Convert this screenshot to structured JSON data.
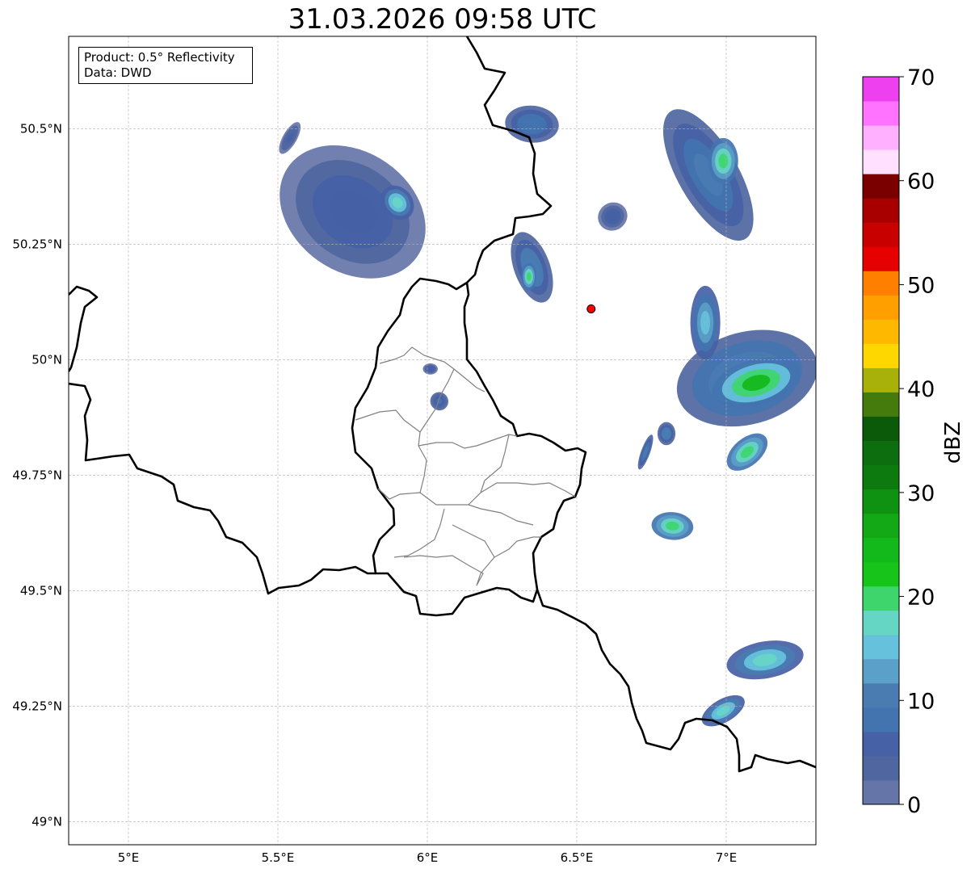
{
  "title": "31.03.2026 09:58 UTC",
  "info": {
    "product": "Product: 0.5° Reflectivity",
    "data": "Data: DWD"
  },
  "map": {
    "lon_range": [
      4.8,
      7.3
    ],
    "lat_range": [
      48.95,
      50.7
    ],
    "lon_ticks": [
      {
        "value": 5.0,
        "label": "5°E"
      },
      {
        "value": 5.5,
        "label": "5.5°E"
      },
      {
        "value": 6.0,
        "label": "6°E"
      },
      {
        "value": 6.5,
        "label": "6.5°E"
      },
      {
        "value": 7.0,
        "label": "7°E"
      }
    ],
    "lat_ticks": [
      {
        "value": 49.0,
        "label": "49°N"
      },
      {
        "value": 49.25,
        "label": "49.25°N"
      },
      {
        "value": 49.5,
        "label": "49.5°N"
      },
      {
        "value": 49.75,
        "label": "49.75°N"
      },
      {
        "value": 50.0,
        "label": "50°N"
      },
      {
        "value": 50.25,
        "label": "50.25°N"
      },
      {
        "value": 50.5,
        "label": "50.5°N"
      }
    ],
    "grid": true,
    "radar_site": {
      "lon": 6.548,
      "lat": 50.11,
      "color": "#ff0000"
    }
  },
  "colorbar": {
    "label": "dBZ",
    "min": 0,
    "max": 70,
    "step": 2.5,
    "ticks": [
      {
        "value": 0,
        "label": "0"
      },
      {
        "value": 10,
        "label": "10"
      },
      {
        "value": 20,
        "label": "20"
      },
      {
        "value": 30,
        "label": "30"
      },
      {
        "value": 40,
        "label": "40"
      },
      {
        "value": 50,
        "label": "50"
      },
      {
        "value": 60,
        "label": "60"
      },
      {
        "value": 70,
        "label": "70"
      }
    ],
    "colors": [
      "#6675a8",
      "#4f66a0",
      "#4661a6",
      "#4374b0",
      "#4a7cb2",
      "#5aa0c8",
      "#66c2dc",
      "#66d6c4",
      "#3ed66c",
      "#16c41a",
      "#13b81a",
      "#12a816",
      "#0f9212",
      "#0c7a0f",
      "#0c6e0e",
      "#0a5a0a",
      "#457a0c",
      "#a8b00a",
      "#ffd700",
      "#ffb800",
      "#ff9f00",
      "#ff7f00",
      "#e60000",
      "#c80000",
      "#a80000",
      "#7a0000",
      "#ffe0ff",
      "#ffb0ff",
      "#ff73ff",
      "#ee40ee"
    ]
  },
  "echoes": [
    {
      "name": "cell-nw-large",
      "lon": 5.75,
      "lat": 50.32,
      "rx": 0.2,
      "ry": 0.17,
      "rot": -55,
      "dbz": 6
    },
    {
      "name": "cell-nw-core",
      "lon": 5.9,
      "lat": 50.34,
      "rx": 0.05,
      "ry": 0.04,
      "rot": -40,
      "dbz": 18
    },
    {
      "name": "cell-nw-streak",
      "lon": 5.54,
      "lat": 50.48,
      "rx": 0.06,
      "ry": 0.015,
      "rot": -60,
      "dbz": 5
    },
    {
      "name": "cell-n-border",
      "lon": 6.35,
      "lat": 50.51,
      "rx": 0.09,
      "ry": 0.04,
      "rot": 5,
      "dbz": 9
    },
    {
      "name": "cell-mid-north",
      "lon": 6.35,
      "lat": 50.2,
      "rx": 0.06,
      "ry": 0.08,
      "rot": -20,
      "dbz": 12
    },
    {
      "name": "cell-mid-north-core",
      "lon": 6.34,
      "lat": 50.18,
      "rx": 0.025,
      "ry": 0.03,
      "rot": 0,
      "dbz": 22
    },
    {
      "name": "cell-ne-band",
      "lon": 6.94,
      "lat": 50.4,
      "rx": 0.1,
      "ry": 0.16,
      "rot": -30,
      "dbz": 10
    },
    {
      "name": "cell-ne-core",
      "lon": 6.99,
      "lat": 50.43,
      "rx": 0.05,
      "ry": 0.05,
      "rot": 0,
      "dbz": 22
    },
    {
      "name": "cell-ne-small",
      "lon": 6.62,
      "lat": 50.31,
      "rx": 0.05,
      "ry": 0.03,
      "rot": -30,
      "dbz": 7
    },
    {
      "name": "cell-e-large",
      "lon": 7.07,
      "lat": 49.96,
      "rx": 0.24,
      "ry": 0.1,
      "rot": -15,
      "dbz": 14
    },
    {
      "name": "cell-e-core",
      "lon": 7.1,
      "lat": 49.95,
      "rx": 0.15,
      "ry": 0.05,
      "rot": -15,
      "dbz": 26
    },
    {
      "name": "cell-e-tail",
      "lon": 6.93,
      "lat": 50.08,
      "rx": 0.05,
      "ry": 0.08,
      "rot": 0,
      "dbz": 16
    },
    {
      "name": "cell-e-lower",
      "lon": 7.07,
      "lat": 49.8,
      "rx": 0.08,
      "ry": 0.03,
      "rot": -40,
      "dbz": 22
    },
    {
      "name": "cell-e-small-1",
      "lon": 6.8,
      "lat": 49.84,
      "rx": 0.03,
      "ry": 0.025,
      "rot": 0,
      "dbz": 12
    },
    {
      "name": "cell-e-small-2",
      "lon": 6.73,
      "lat": 49.8,
      "rx": 0.015,
      "ry": 0.04,
      "rot": 20,
      "dbz": 10
    },
    {
      "name": "cell-se-mid",
      "lon": 6.82,
      "lat": 49.64,
      "rx": 0.07,
      "ry": 0.03,
      "rot": 5,
      "dbz": 22
    },
    {
      "name": "cell-se-lower",
      "lon": 7.13,
      "lat": 49.35,
      "rx": 0.13,
      "ry": 0.04,
      "rot": -10,
      "dbz": 18
    },
    {
      "name": "cell-se-lower-2",
      "lon": 6.99,
      "lat": 49.24,
      "rx": 0.08,
      "ry": 0.025,
      "rot": -30,
      "dbz": 18
    },
    {
      "name": "cell-lux-north",
      "lon": 6.04,
      "lat": 49.91,
      "rx": 0.03,
      "ry": 0.02,
      "rot": -30,
      "dbz": 8
    },
    {
      "name": "cell-lux-north-2",
      "lon": 6.01,
      "lat": 49.98,
      "rx": 0.025,
      "ry": 0.012,
      "rot": 0,
      "dbz": 6
    }
  ]
}
